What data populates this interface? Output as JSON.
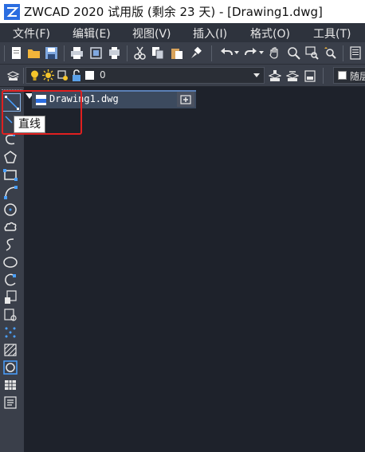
{
  "window": {
    "title": "ZWCAD 2020 试用版 (剩余 23 天) - [Drawing1.dwg]"
  },
  "menubar": {
    "items": [
      {
        "label": "文件(F)"
      },
      {
        "label": "编辑(E)"
      },
      {
        "label": "视图(V)"
      },
      {
        "label": "插入(I)"
      },
      {
        "label": "格式(O)"
      },
      {
        "label": "工具(T)"
      }
    ]
  },
  "layer_bar": {
    "current_layer": "0",
    "color_label": "随层"
  },
  "tabs": {
    "active": {
      "label": "Drawing1.dwg",
      "close": "✕"
    },
    "new_tab": "+"
  },
  "tooltip": {
    "text": "直线"
  },
  "colors": {
    "canvas_bg": "#1e222b",
    "toolbar_bg": "#3a3f4a",
    "highlight": "#e02020",
    "tab_active": "#3c4a5e"
  }
}
